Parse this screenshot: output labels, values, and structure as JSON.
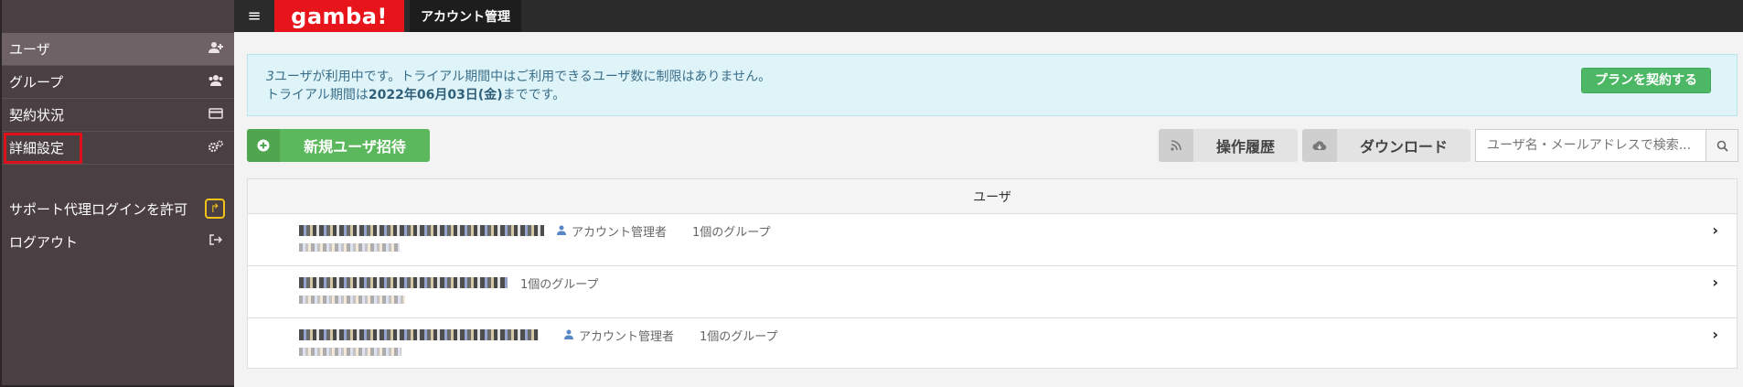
{
  "sidebar": {
    "items": [
      {
        "label": "ユーザ",
        "icon": "user-plus-icon",
        "active": true
      },
      {
        "label": "グループ",
        "icon": "users-icon",
        "active": false
      },
      {
        "label": "契約状況",
        "icon": "credit-card-icon",
        "active": false
      },
      {
        "label": "詳細設定",
        "icon": "gears-icon",
        "active": false
      }
    ],
    "support_login": "サポート代理ログインを許可",
    "logout": "ログアウト"
  },
  "topbar": {
    "menu_icon": "≡",
    "logo": "gamba!",
    "tab": "アカウント管理"
  },
  "notice": {
    "count": "3",
    "line1_rest": "ユーザが利用中です。トライアル期間中はご利用できるユーザ数に制限はありません。",
    "line2_prefix": "トライアル期間は",
    "line2_date": "2022年06月03日(金)",
    "line2_suffix": "までです。",
    "plan_button": "プランを契約する"
  },
  "toolbar": {
    "invite_label": "新規ユーザ招待",
    "history_label": "操作履歴",
    "download_label": "ダウンロード",
    "search_placeholder": "ユーザ名・メールアドレスで検索..."
  },
  "user_table": {
    "header": "ユーザ",
    "rows": [
      {
        "role": "アカウント管理者",
        "groups": "1個のグループ"
      },
      {
        "role": "",
        "groups": "1個のグループ"
      },
      {
        "role": "アカウント管理者",
        "groups": "1個のグループ"
      }
    ]
  },
  "colors": {
    "sidebar_bg": "#4a3f43",
    "logo_red": "#e8141c",
    "accent_green": "#5cb85c",
    "notice_bg": "#dff4f8",
    "highlight_red": "#e0101a"
  }
}
